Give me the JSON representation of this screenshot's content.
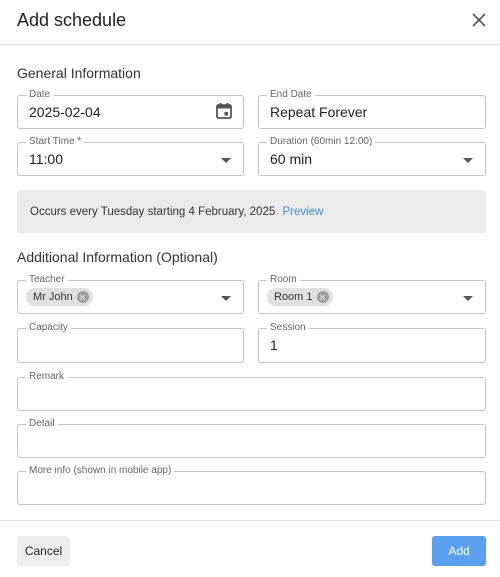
{
  "dialog": {
    "title": "Add schedule"
  },
  "sections": {
    "general": "General Information",
    "additional": "Additional Information (Optional)"
  },
  "fields": {
    "date": {
      "label": "Date",
      "value": "2025-02-04",
      "icon": "calendar-icon"
    },
    "end_date": {
      "label": "End Date",
      "value": "Repeat Forever"
    },
    "start_time": {
      "label": "Start Time *",
      "value": "11:00"
    },
    "duration": {
      "label": "Duration (60min 12:00)",
      "value": "60 min"
    },
    "teacher": {
      "label": "Teacher",
      "chip": "Mr John"
    },
    "room": {
      "label": "Room",
      "chip": "Room 1"
    },
    "capacity": {
      "label": "Capacity",
      "value": ""
    },
    "session": {
      "label": "Session",
      "value": "1"
    },
    "remark": {
      "label": "Remark",
      "value": ""
    },
    "detail": {
      "label": "Detail",
      "value": ""
    },
    "more_info": {
      "label": "More info (shown in mobile app)",
      "value": ""
    }
  },
  "occurrence": {
    "text": "Occurs every Tuesday starting 4 February, 2025",
    "preview_label": "Preview"
  },
  "footer": {
    "cancel_label": "Cancel",
    "add_label": "Add"
  },
  "colors": {
    "primary": "#5aa0ee",
    "link": "#4a8fd8",
    "info_bg": "#ebebeb"
  }
}
